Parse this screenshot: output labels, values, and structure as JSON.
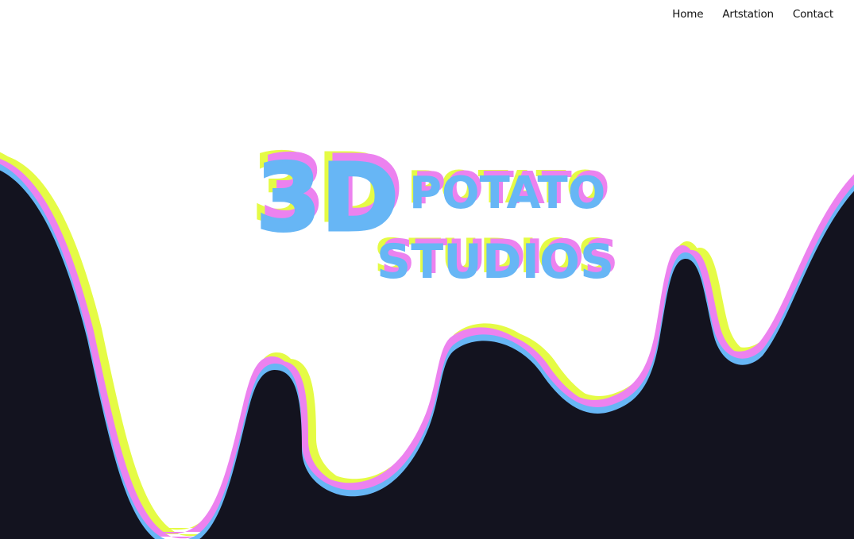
{
  "nav": {
    "items": [
      {
        "label": "Home"
      },
      {
        "label": "Artstation"
      },
      {
        "label": "Contact"
      }
    ]
  },
  "logo": {
    "line1_big": "3D",
    "line1_small": "POTATO",
    "line2": "STUDIOS"
  },
  "colors": {
    "background": "#ffffff",
    "dark_fill": "#13131f",
    "yellow": "#e5fb45",
    "pink": "#ec82ef",
    "blue": "#67b6f5",
    "nav_text": "#111111"
  }
}
